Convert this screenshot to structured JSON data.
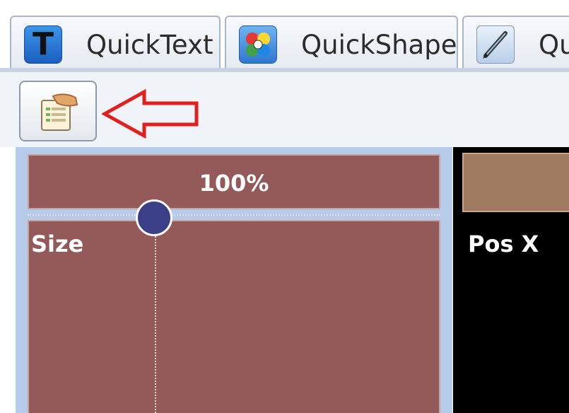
{
  "tabs": [
    {
      "label": "QuickText",
      "icon": "text-t-icon"
    },
    {
      "label": "QuickShape",
      "icon": "shape-icon"
    },
    {
      "label": "Qu",
      "icon": "pen-icon"
    }
  ],
  "toolbar": {
    "button_icon": "clipboard-hand-icon",
    "arrow_icon": "red-arrow-icon"
  },
  "size_slider": {
    "value": "100%",
    "label": "Size",
    "level": 0.31
  },
  "pos_x_panel": {
    "label": "Pos X"
  },
  "colors": {
    "panel_red": "#935a59",
    "panel_brown": "#a07a60",
    "knob": "#3b3f87",
    "arrow_red": "#e0201e",
    "panel_border": "#b6cbe9"
  }
}
